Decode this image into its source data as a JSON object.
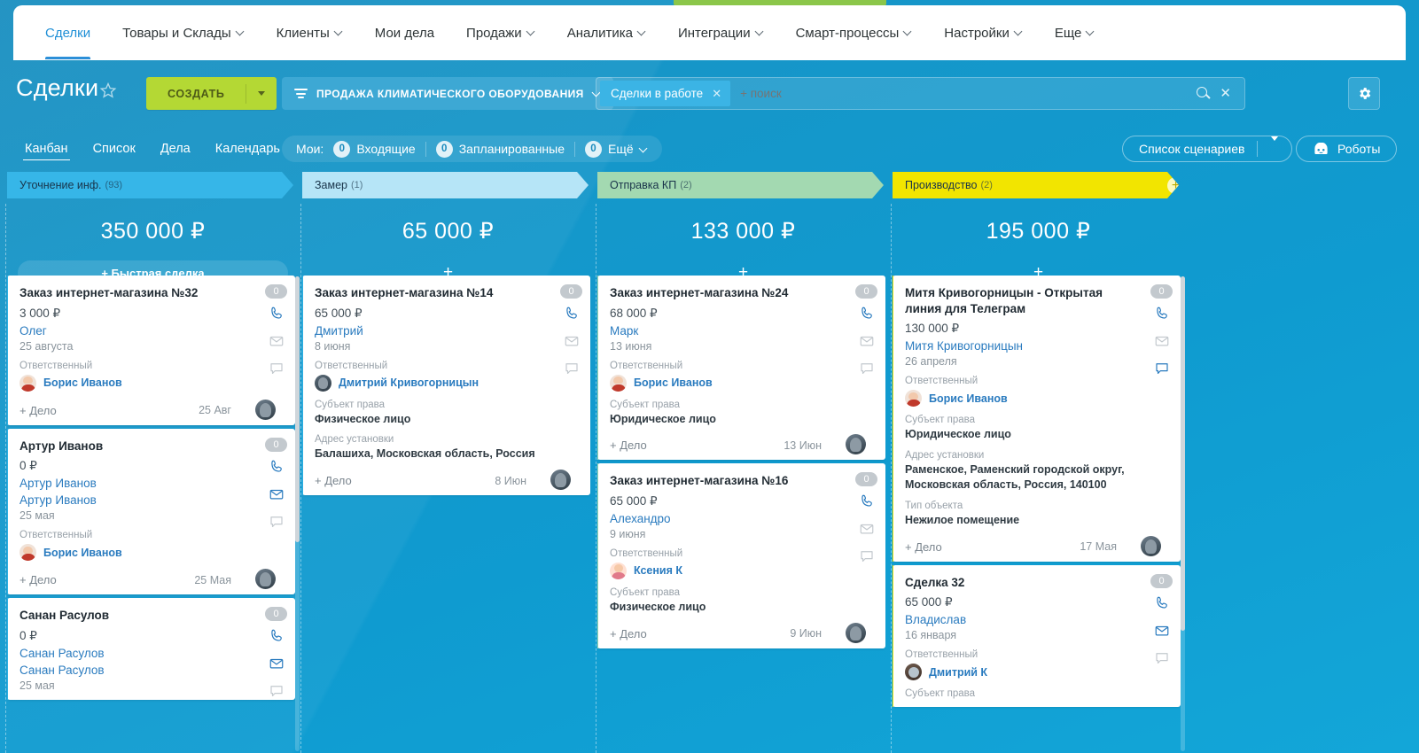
{
  "topnav": {
    "items": [
      {
        "label": "Сделки",
        "has_chevron": false,
        "active": true
      },
      {
        "label": "Товары и Склады",
        "has_chevron": true,
        "active": false
      },
      {
        "label": "Клиенты",
        "has_chevron": true,
        "active": false
      },
      {
        "label": "Мои дела",
        "has_chevron": false,
        "active": false
      },
      {
        "label": "Продажи",
        "has_chevron": true,
        "active": false
      },
      {
        "label": "Аналитика",
        "has_chevron": true,
        "active": false
      },
      {
        "label": "Интеграции",
        "has_chevron": true,
        "active": false
      },
      {
        "label": "Смарт-процессы",
        "has_chevron": true,
        "active": false
      },
      {
        "label": "Настройки",
        "has_chevron": true,
        "active": false
      },
      {
        "label": "Еще",
        "has_chevron": true,
        "active": false
      }
    ]
  },
  "header": {
    "title": "Сделки",
    "star_icon": "star-outline-icon",
    "create_button": "СОЗДАТЬ",
    "create_dropdown_icon": "caret-down-icon",
    "funnel_label": "ПРОДАЖА КЛИМАТИЧЕСКОГО ОБОРУДОВАНИЯ",
    "funnel_icon": "filter-funnel-icon",
    "search": {
      "tag": "Сделки в работе",
      "tag_remove_icon": "close-x-icon",
      "placeholder": "+ поиск",
      "value": "",
      "search_icon": "search-icon",
      "clear_icon": "close-x-icon"
    },
    "settings_icon": "gear-icon"
  },
  "subbar": {
    "tabs": [
      {
        "label": "Канбан",
        "active": true
      },
      {
        "label": "Список",
        "active": false
      },
      {
        "label": "Дела",
        "active": false
      },
      {
        "label": "Календарь",
        "active": false
      }
    ],
    "mine_label": "Мои:",
    "counters": [
      {
        "count": "0",
        "label": "Входящие",
        "chevron": false
      },
      {
        "count": "0",
        "label": "Запланированные",
        "chevron": false
      },
      {
        "count": "0",
        "label": "Ещё",
        "chevron": true
      }
    ],
    "scenarios_button": "Список сценариев",
    "scenarios_dropdown_icon": "caret-down-icon",
    "robots_button": "Роботы",
    "robots_icon": "robot-icon"
  },
  "board": {
    "columns": [
      {
        "name": "Уточнение инф.",
        "count": "(93)",
        "header_color": "#36b6e8",
        "total": "350 000 ₽",
        "add_label": "+ Быстрая сделка",
        "has_quick_deal": true,
        "has_plus_badge": false,
        "stage_class": "stage-1",
        "cards": [
          {
            "title": "Заказ интернет-магазина №32",
            "amount": "3 000 ₽",
            "links": [
              "Олег"
            ],
            "date": "25 августа",
            "fields": [
              {
                "label": "Ответственный",
                "type": "person",
                "value": "Борис Иванов",
                "avatar": "av-boris"
              }
            ],
            "footer_action": "+ Дело",
            "footer_date": "25 Авг",
            "badge": "0",
            "icons": [
              "phone-icon",
              "mail-icon",
              "chat-icon"
            ],
            "icon_states": [
              "active",
              "muted",
              "muted"
            ]
          },
          {
            "title": "Артур Иванов",
            "amount": "0 ₽",
            "links": [
              "Артур Иванов",
              "Артур Иванов"
            ],
            "date": "25 мая",
            "fields": [
              {
                "label": "Ответственный",
                "type": "person",
                "value": "Борис Иванов",
                "avatar": "av-boris"
              }
            ],
            "footer_action": "+ Дело",
            "footer_date": "25 Мая",
            "badge": "0",
            "icons": [
              "phone-icon",
              "mail-icon",
              "chat-icon"
            ],
            "icon_states": [
              "active",
              "active",
              "muted"
            ]
          },
          {
            "title": "Санан Расулов",
            "amount": "0 ₽",
            "links": [
              "Санан Расулов",
              "Санан Расулов"
            ],
            "date": "25 мая",
            "fields": [],
            "footer_action": "",
            "footer_date": "",
            "badge": "0",
            "icons": [
              "phone-icon",
              "mail-icon",
              "chat-icon"
            ],
            "icon_states": [
              "active",
              "active",
              "muted"
            ]
          }
        ]
      },
      {
        "name": "Замер",
        "count": "(1)",
        "header_color": "#b6e5f7",
        "total": "65 000 ₽",
        "add_label": "+",
        "has_quick_deal": false,
        "has_plus_badge": false,
        "stage_class": "stage-2",
        "cards": [
          {
            "title": "Заказ интернет-магазина №14",
            "amount": "65 000 ₽",
            "links": [
              "Дмитрий"
            ],
            "date": "8 июня",
            "fields": [
              {
                "label": "Ответственный",
                "type": "person",
                "value": "Дмитрий Кривогорницын",
                "avatar": "av-dmitry"
              },
              {
                "label": "Субъект права",
                "type": "text",
                "value": "Физическое лицо"
              },
              {
                "label": "Адрес установки",
                "type": "text",
                "value": "Балашиха, Московская область, Россия"
              }
            ],
            "footer_action": "+ Дело",
            "footer_date": "8 Июн",
            "badge": "0",
            "icons": [
              "phone-icon",
              "mail-icon",
              "chat-icon"
            ],
            "icon_states": [
              "active",
              "muted",
              "muted"
            ]
          }
        ]
      },
      {
        "name": "Отправка КП",
        "count": "(2)",
        "header_color": "#a3d9b1",
        "total": "133 000 ₽",
        "add_label": "+",
        "has_quick_deal": false,
        "has_plus_badge": false,
        "stage_class": "stage-3",
        "cards": [
          {
            "title": "Заказ интернет-магазина №24",
            "amount": "68 000 ₽",
            "links": [
              "Марк"
            ],
            "date": "13 июня",
            "fields": [
              {
                "label": "Ответственный",
                "type": "person",
                "value": "Борис Иванов",
                "avatar": "av-boris"
              },
              {
                "label": "Субъект права",
                "type": "text",
                "value": "Юридическое лицо"
              }
            ],
            "footer_action": "+ Дело",
            "footer_date": "13 Июн",
            "badge": "0",
            "icons": [
              "phone-icon",
              "mail-icon",
              "chat-icon"
            ],
            "icon_states": [
              "active",
              "muted",
              "muted"
            ]
          },
          {
            "title": "Заказ интернет-магазина №16",
            "amount": "65 000 ₽",
            "links": [
              "Алехандро"
            ],
            "date": "9 июня",
            "fields": [
              {
                "label": "Ответственный",
                "type": "person",
                "value": "Ксения К",
                "avatar": "av-ksenia"
              },
              {
                "label": "Субъект права",
                "type": "text",
                "value": "Физическое лицо"
              }
            ],
            "footer_action": "+ Дело",
            "footer_date": "9 Июн",
            "badge": "0",
            "icons": [
              "phone-icon",
              "mail-icon",
              "chat-icon"
            ],
            "icon_states": [
              "active",
              "muted",
              "muted"
            ]
          }
        ]
      },
      {
        "name": "Производство",
        "count": "(2)",
        "header_color": "#f2e500",
        "total": "195 000 ₽",
        "add_label": "+",
        "has_quick_deal": false,
        "has_plus_badge": true,
        "plus_badge_icon": "plus-circle-icon",
        "stage_class": "stage-4",
        "cards": [
          {
            "title": "Митя Кривогорницын - Открытая линия для Телеграм",
            "amount": "130 000 ₽",
            "links": [
              "Митя Кривогорницын"
            ],
            "date": "26 апреля",
            "fields": [
              {
                "label": "Ответственный",
                "type": "person",
                "value": "Борис Иванов",
                "avatar": "av-boris"
              },
              {
                "label": "Субъект права",
                "type": "text",
                "value": "Юридическое лицо"
              },
              {
                "label": "Адрес установки",
                "type": "text",
                "value": "Раменское, Раменский городской округ, Московская область, Россия, 140100"
              },
              {
                "label": "Тип объекта",
                "type": "text",
                "value": "Нежилое помещение"
              }
            ],
            "footer_action": "+ Дело",
            "footer_date": "17 Мая",
            "badge": "0",
            "icons": [
              "phone-icon",
              "mail-icon",
              "chat-icon"
            ],
            "icon_states": [
              "active",
              "muted",
              "active"
            ]
          },
          {
            "title": "Сделка 32",
            "amount": "65 000 ₽",
            "links": [
              "Владислав"
            ],
            "date": "16 января",
            "fields": [
              {
                "label": "Ответственный",
                "type": "person",
                "value": "Дмитрий К",
                "avatar": "av-dmitryk"
              },
              {
                "label": "Субъект права",
                "type": "text",
                "value": ""
              }
            ],
            "footer_action": "",
            "footer_date": "",
            "badge": "0",
            "icons": [
              "phone-icon",
              "mail-icon",
              "chat-icon"
            ],
            "icon_states": [
              "active",
              "active",
              "muted"
            ]
          }
        ]
      }
    ]
  }
}
